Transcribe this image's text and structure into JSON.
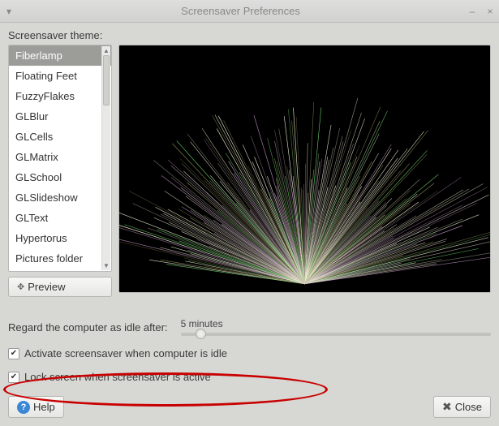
{
  "window": {
    "title": "Screensaver Preferences"
  },
  "theme_label": "Screensaver theme:",
  "themes": [
    "Fiberlamp",
    "Floating Feet",
    "FuzzyFlakes",
    "GLBlur",
    "GLCells",
    "GLMatrix",
    "GLSchool",
    "GLSlideshow",
    "GLText",
    "Hypertorus",
    "Pictures folder"
  ],
  "selected_theme_index": 0,
  "preview_button": "Preview",
  "idle": {
    "label": "Regard the computer as idle after:",
    "value_text": "5 minutes"
  },
  "checkbox_activate": "Activate screensaver when computer is idle",
  "checkbox_lock": "Lock screen when screensaver is active",
  "help_button": "Help",
  "close_button": "Close",
  "annotation": {
    "shape": "ellipse",
    "target": "lock-screen-checkbox-row",
    "color": "#c80000"
  }
}
